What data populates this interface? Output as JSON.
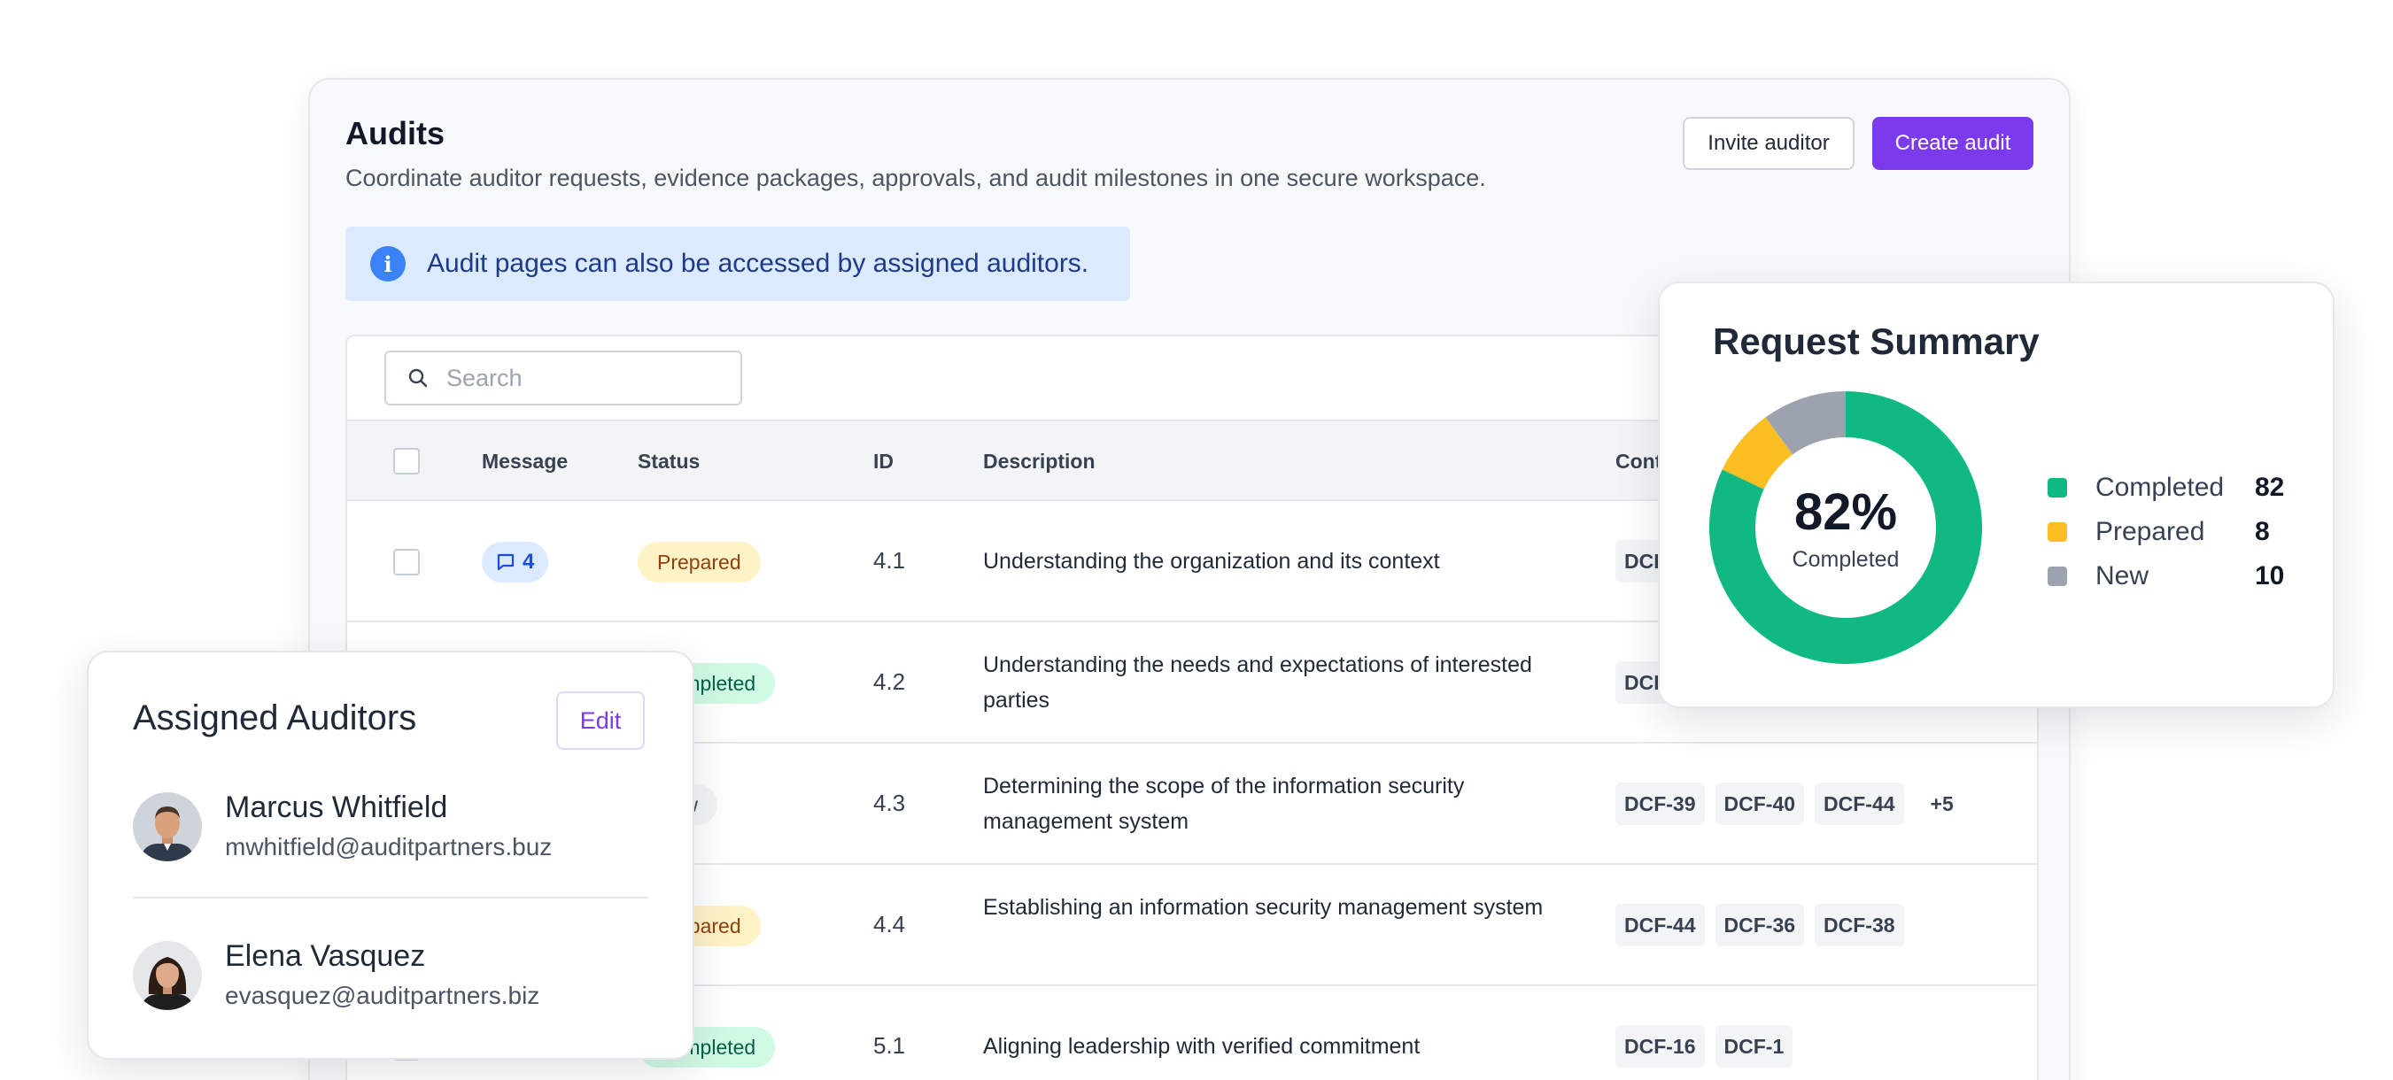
{
  "header": {
    "title": "Audits",
    "subtitle": "Coordinate auditor requests, evidence packages, approvals, and audit milestones in one secure workspace.",
    "invite_label": "Invite auditor",
    "create_label": "Create audit"
  },
  "banner": {
    "text": "Audit pages can also be accessed by assigned auditors."
  },
  "search": {
    "placeholder": "Search"
  },
  "table": {
    "columns": {
      "message": "Message",
      "status": "Status",
      "id": "ID",
      "description": "Description",
      "controls": "Controls"
    },
    "rows": [
      {
        "message_count": "4",
        "status": "Prepared",
        "id": "4.1",
        "description": "Understanding the organization and its context",
        "controls": [
          "DCF-"
        ],
        "more": ""
      },
      {
        "message_count": "",
        "status": "Completed",
        "id": "4.2",
        "description": "Understanding the needs and expectations of interested parties",
        "controls": [
          "DCF-"
        ],
        "more": ""
      },
      {
        "message_count": "",
        "status": "New",
        "id": "4.3",
        "description": "Determining the scope of the information security management system",
        "controls": [
          "DCF-39",
          "DCF-40",
          "DCF-44"
        ],
        "more": "+5"
      },
      {
        "message_count": "",
        "status": "Prepared",
        "id": "4.4",
        "description": "Establishing an information security management system",
        "controls": [
          "DCF-44",
          "DCF-36",
          "DCF-38"
        ],
        "more": ""
      },
      {
        "message_count": "",
        "status": "Completed",
        "id": "5.1",
        "description": "Aligning leadership with verified commitment",
        "controls": [
          "DCF-16",
          "DCF-1"
        ],
        "more": ""
      }
    ]
  },
  "status_colors": {
    "Prepared": {
      "bg": "#fef3c7",
      "fg": "#92400e"
    },
    "Completed": {
      "bg": "#d1fae5",
      "fg": "#065f46"
    },
    "New": {
      "bg": "#f3f4f6",
      "fg": "#374151"
    }
  },
  "summary": {
    "title": "Request Summary",
    "percent": "82%",
    "percent_label": "Completed",
    "legend": [
      {
        "label": "Completed",
        "value": 82,
        "color": "#10b981"
      },
      {
        "label": "Prepared",
        "value": 8,
        "color": "#fbbf24"
      },
      {
        "label": "New",
        "value": 10,
        "color": "#9ca3af"
      }
    ]
  },
  "auditors": {
    "title": "Assigned Auditors",
    "edit_label": "Edit",
    "people": [
      {
        "name": "Marcus Whitfield",
        "email": "mwhitfield@auditpartners.buz",
        "avatar_icon": "man-avatar"
      },
      {
        "name": "Elena Vasquez",
        "email": "evasquez@auditpartners.biz",
        "avatar_icon": "woman-avatar"
      }
    ]
  },
  "colors": {
    "accent": "#7c3aed",
    "info": "#3b82f6"
  }
}
